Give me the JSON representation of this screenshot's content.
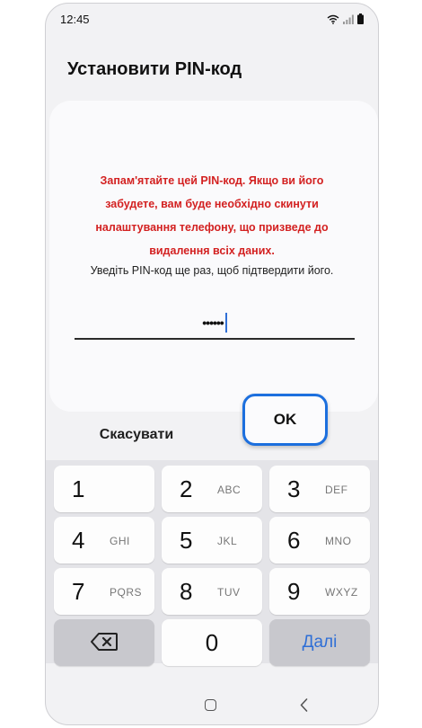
{
  "status_bar": {
    "time": "12:45",
    "icons": [
      "wifi-icon",
      "signal-icon",
      "battery-icon"
    ]
  },
  "screen": {
    "title": "Установити PIN-код",
    "warning": "Запам'ятайте цей PIN-код. Якщо ви його забудете, вам буде необхідно скинути налаштування телефону, що призведе до видалення всіх даних.",
    "hint": "Уведіть PIN-код ще раз, щоб підтвердити його.",
    "pin_value": "••••••"
  },
  "buttons": {
    "cancel": "Скасувати",
    "ok": "OK"
  },
  "keypad": {
    "keys": [
      {
        "num": "1",
        "letters": ""
      },
      {
        "num": "2",
        "letters": "ABC"
      },
      {
        "num": "3",
        "letters": "DEF"
      },
      {
        "num": "4",
        "letters": "GHI"
      },
      {
        "num": "5",
        "letters": "JKL"
      },
      {
        "num": "6",
        "letters": "MNO"
      },
      {
        "num": "7",
        "letters": "PQRS"
      },
      {
        "num": "8",
        "letters": "TUV"
      },
      {
        "num": "9",
        "letters": "WXYZ"
      },
      {
        "num": "0",
        "letters": ""
      }
    ],
    "next_label": "Далі",
    "backspace_icon": "backspace-icon"
  },
  "navigation": {
    "icons": [
      "home-icon",
      "back-icon"
    ]
  },
  "colors": {
    "warning_text": "#d32121",
    "accent": "#2f6fd6",
    "highlight_border": "#1c6fde"
  }
}
